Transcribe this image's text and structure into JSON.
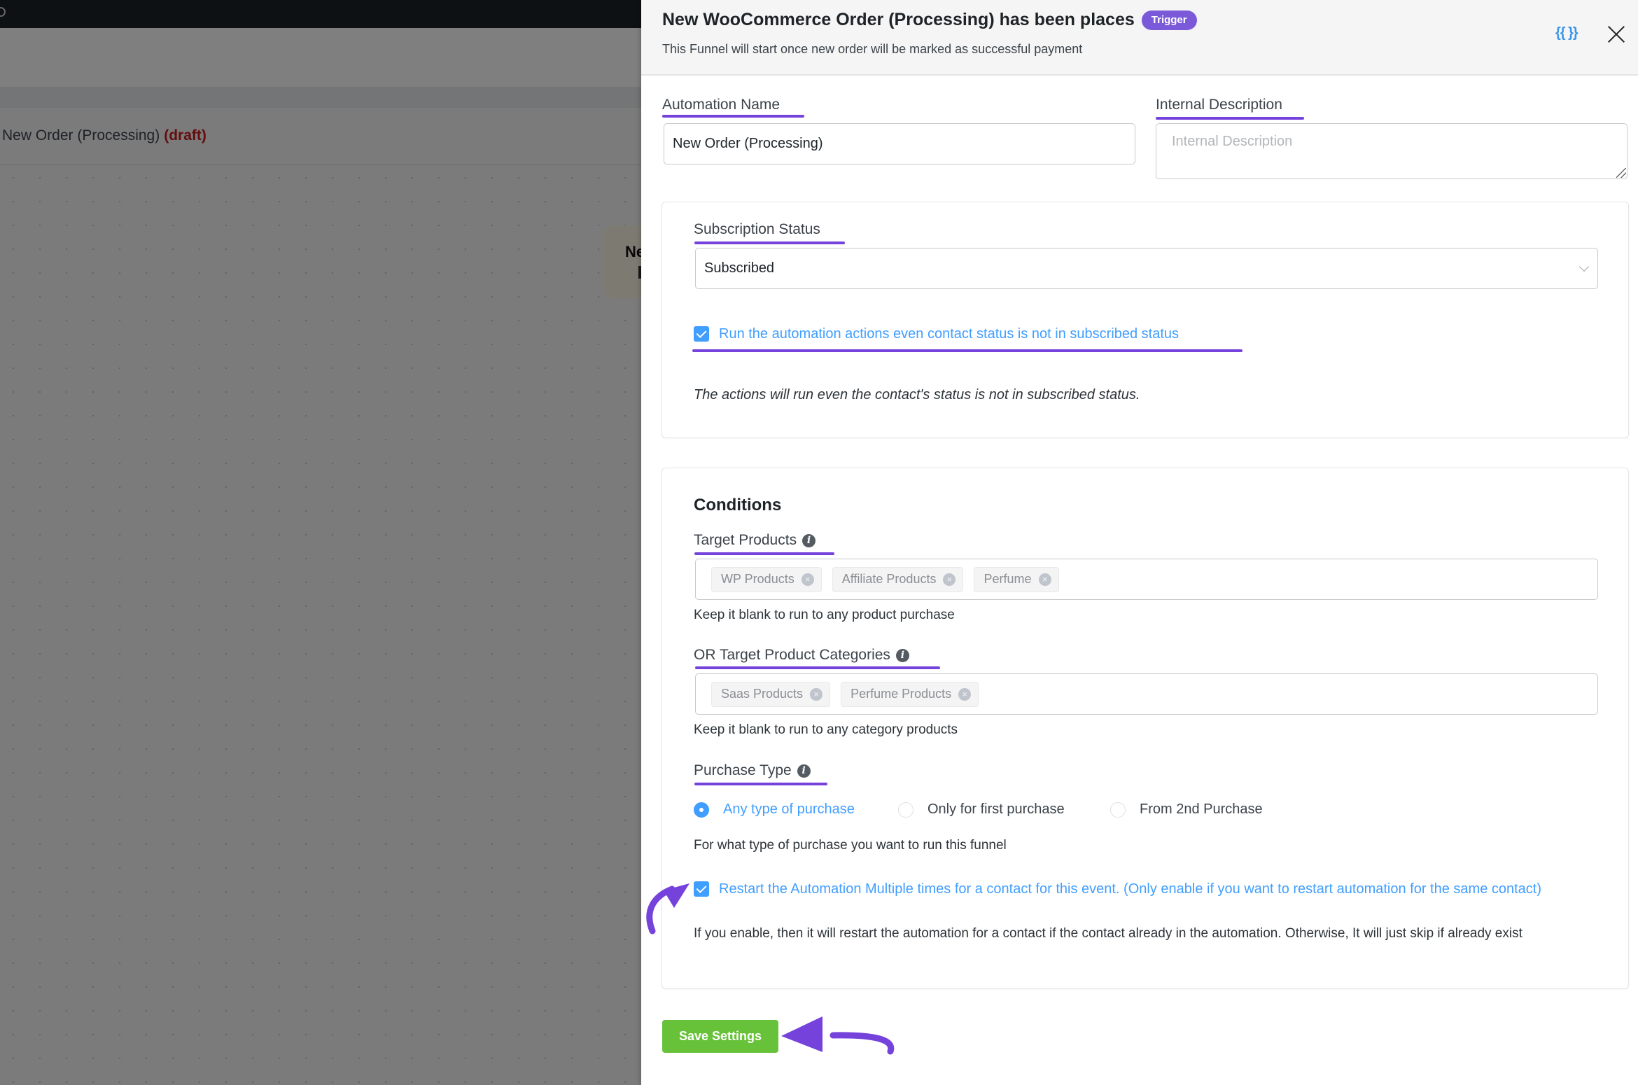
{
  "background": {
    "automation_title": "New Order (Processing)",
    "status_tag": "(draft)",
    "node_title_partial": "Ne"
  },
  "panel": {
    "title": "New WooCommerce Order (Processing) has been places",
    "badge": "Trigger",
    "subtitle": "This Funnel will start once new order will be marked as successful payment",
    "smartcode_icon": "{{ }}",
    "close_icon": "close-icon"
  },
  "form": {
    "automation_name": {
      "label": "Automation Name",
      "value": "New Order (Processing)"
    },
    "internal_description": {
      "label": "Internal Description",
      "value": "",
      "placeholder": "Internal Description"
    },
    "subscription": {
      "label": "Subscription Status",
      "selected": "Subscribed",
      "run_anyway": {
        "checked": true,
        "label": "Run the automation actions even contact status is not in subscribed status"
      },
      "note": "The actions will run even the contact's status is not in subscribed status."
    },
    "conditions": {
      "title": "Conditions",
      "target_products": {
        "label": "Target Products",
        "tags": [
          "WP Products",
          "Affiliate Products",
          "Perfume"
        ],
        "hint": "Keep it blank to run to any product purchase"
      },
      "target_categories": {
        "label": "OR Target Product Categories",
        "tags": [
          "Saas Products",
          "Perfume Products"
        ],
        "hint": "Keep it blank to run to any category products"
      },
      "purchase_type": {
        "label": "Purchase Type",
        "options": [
          {
            "label": "Any type of purchase",
            "checked": true
          },
          {
            "label": "Only for first purchase",
            "checked": false
          },
          {
            "label": "From 2nd Purchase",
            "checked": false
          }
        ],
        "hint": "For what type of purchase you want to run this funnel"
      },
      "restart": {
        "checked": true,
        "label": "Restart the Automation Multiple times for a contact for this event. (Only enable if you want to restart automation for the same contact)",
        "description": "If you enable, then it will restart the automation for a contact if the contact already in the automation. Otherwise, It will just skip if already exist"
      }
    },
    "save_label": "Save Settings"
  },
  "colors": {
    "accent_blue": "#409eff",
    "badge_purple": "#7b5ad9",
    "annotation_purple": "#7542db",
    "save_green": "#67c23a",
    "draft_red": "#c61b1b"
  }
}
